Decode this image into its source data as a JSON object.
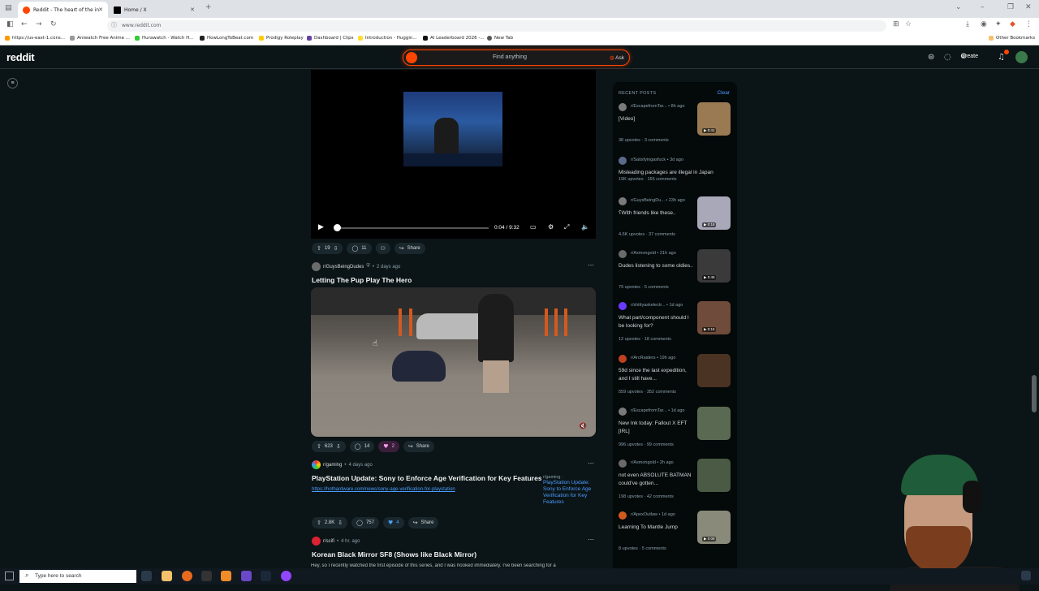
{
  "browser": {
    "tabs": [
      {
        "label": "Reddit - The heart of the in",
        "active": true
      },
      {
        "label": "Home / X",
        "active": false
      }
    ],
    "url": "www.reddit.com",
    "bookmarks": [
      "https://us-east-1.cons...",
      "Aniwatch Free Anime ...",
      "Hurawatch - Watch H...",
      "HowLongToBeat.com",
      "Prodigy Roleplay",
      "Dashboard | Clips",
      "Introduction - Huggin...",
      "AI Leaderboard 2026 -...",
      "New Tab"
    ],
    "other_bookmarks": "Other Bookmarks"
  },
  "reddit": {
    "logo": "reddit",
    "search_placeholder": "Find anything",
    "ask_label": "Ask",
    "create_label": "Create"
  },
  "feed": {
    "player": {
      "time": "0:04 / 9:32"
    },
    "post1_actions": {
      "votes": "19",
      "comments": "11",
      "share": "Share"
    },
    "post2": {
      "subreddit": "r/GuysBeingDudes",
      "age": "2 days ago",
      "title": "Letting The Pup Play The Hero",
      "votes": "623",
      "comments": "14",
      "awards": "2",
      "share": "Share"
    },
    "post3": {
      "subreddit": "r/gaming",
      "age": "4 days ago",
      "title": "PlayStation Update: Sony to Enforce Age Verification for Key Features",
      "link": "https://hothardware.com/news/sony-age-verification-for-playstation",
      "thumb_sub": "r/gaming ·",
      "thumb_title": "PlayStation Update: Sony to Enforce Age Verification for Key Features",
      "votes": "2.8K",
      "comments": "757",
      "awards": "4",
      "share": "Share"
    },
    "post4": {
      "subreddit": "r/scifi",
      "age": "4 hr. ago",
      "title": "Korean Black Mirror SF8 (Shows like Black Mirror)",
      "body": "Hey, so I recently watched the first episode of this series, and I was hooked immediately. I've been searching for a"
    }
  },
  "recent": {
    "heading": "RECENT POSTS",
    "clear": "Clear",
    "posts": [
      {
        "sub": "r/EscapefromTar...",
        "age": "8h ago",
        "title": "[Video]",
        "upvotes": "38 upvotes",
        "comments": "3 comments",
        "duration": "0:41",
        "color": "#9a7a52"
      },
      {
        "sub": "r/Satisfyingasfuck",
        "age": "3d ago",
        "title": "Misleading packages are illegal in Japan",
        "upvotes": "19K upvotes",
        "comments": "165 comments",
        "duration": "",
        "color": ""
      },
      {
        "sub": "r/GuysBeingDu...",
        "age": "23h ago",
        "title": "⸮With friends like these..",
        "upvotes": "4.6K upvotes",
        "comments": "37 comments",
        "duration": "0:18",
        "color": "#a8a8b8"
      },
      {
        "sub": "r/Asmongold",
        "age": "21h ago",
        "title": "Dudes listening to some oldies..",
        "upvotes": "79 upvotes",
        "comments": "5 comments",
        "duration": "0:45",
        "color": "#3a3a3a"
      },
      {
        "sub": "r/shittyaskelectr...",
        "age": "1d ago",
        "title": "What part/component should I be looking for?",
        "upvotes": "12 upvotes",
        "comments": "18 comments",
        "duration": "0:15",
        "color": "#6e4b3a"
      },
      {
        "sub": "r/ArcRaiders",
        "age": "19h ago",
        "title": "59d since the last expedition, and I still have...",
        "upvotes": "559 upvotes",
        "comments": "352 comments",
        "duration": "",
        "color": "#4a3322"
      },
      {
        "sub": "r/EscapefromTar...",
        "age": "1d ago",
        "title": "New Ink today: Fallout X EFT [IRL]",
        "upvotes": "996 upvotes",
        "comments": "99 comments",
        "duration": "",
        "color": "#5a6a52"
      },
      {
        "sub": "r/Asmongold",
        "age": "2h ago",
        "title": "not even ABSOLUTE BATMAN could've gotten...",
        "upvotes": "198 upvotes",
        "comments": "42 comments",
        "duration": "",
        "color": "#4a5a44"
      },
      {
        "sub": "r/ApexOutlaw",
        "age": "1d ago",
        "title": "Learning To Mantle Jump",
        "upvotes": "8 upvotes",
        "comments": "5 comments",
        "duration": "0:09",
        "color": "#8a8a7a"
      }
    ]
  },
  "taskbar": {
    "search_placeholder": "Type here to search"
  },
  "colors": {
    "accent": "#ff4500",
    "link": "#4a9dff",
    "bg": "#0b1416"
  }
}
